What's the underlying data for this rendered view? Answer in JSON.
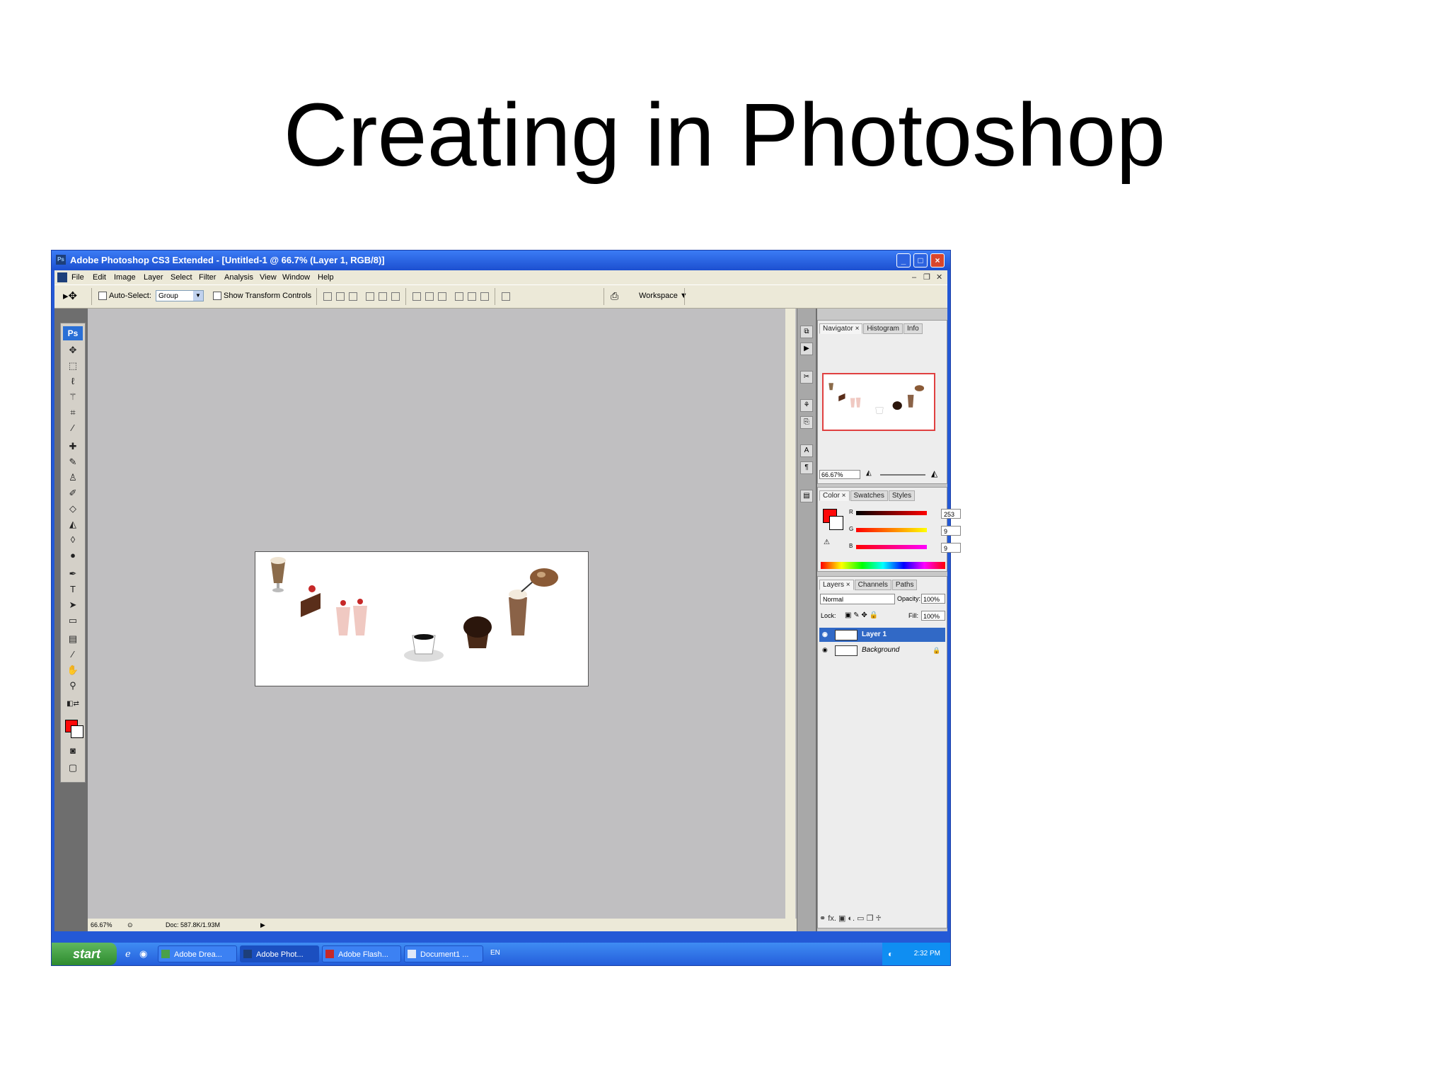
{
  "slide": {
    "title": "Creating in Photoshop"
  },
  "window": {
    "title": "Adobe Photoshop CS3 Extended - [Untitled-1 @ 66.7% (Layer 1, RGB/8)]",
    "menu": [
      "File",
      "Edit",
      "Image",
      "Layer",
      "Select",
      "Filter",
      "Analysis",
      "View",
      "Window",
      "Help"
    ]
  },
  "options": {
    "auto_select_label": "Auto-Select:",
    "auto_select_value": "Group",
    "transform_label": "Show Transform Controls",
    "workspace_label": "Workspace ▼"
  },
  "tools": {
    "logo": "Ps",
    "icons": [
      "move-tool-icon",
      "marquee-tool-icon",
      "lasso-tool-icon",
      "magic-wand-icon",
      "crop-tool-icon",
      "eyedropper-icon",
      "healing-brush-icon",
      "brush-tool-icon",
      "clone-stamp-icon",
      "history-brush-icon",
      "eraser-icon",
      "paint-bucket-icon",
      "blur-tool-icon",
      "dodge-tool-icon",
      "pen-tool-icon",
      "type-tool-icon",
      "path-select-icon",
      "shape-tool-icon",
      "notes-tool-icon",
      "eyedropper-2-icon",
      "hand-tool-icon",
      "zoom-tool-icon"
    ]
  },
  "colors": {
    "foreground": "#fd0909",
    "background": "#ffffff"
  },
  "canvas": {
    "items": [
      "iced-coffee",
      "cake-slice",
      "milkshakes",
      "coffee-cup",
      "muffin",
      "frappe",
      "cookie"
    ]
  },
  "status": {
    "zoom": "66.67%",
    "doc": "Doc: 587.8K/1.93M"
  },
  "navigator": {
    "tabs": [
      "Navigator ×",
      "Histogram",
      "Info"
    ],
    "zoom": "66.67%"
  },
  "color_panel": {
    "tabs": [
      "Color ×",
      "Swatches",
      "Styles"
    ],
    "r_label": "R",
    "r_value": "253",
    "g_label": "G",
    "g_value": "9",
    "b_label": "B",
    "b_value": "9"
  },
  "layers_panel": {
    "tabs": [
      "Layers ×",
      "Channels",
      "Paths"
    ],
    "blend_mode": "Normal",
    "opacity_label": "Opacity:",
    "opacity_value": "100%",
    "lock_label": "Lock:",
    "fill_label": "Fill:",
    "fill_value": "100%",
    "layers": [
      "Layer 1",
      "Background"
    ],
    "footer": "⚭  fx.  ▣  ◐.  ▭  ❒  ♱"
  },
  "taskbar": {
    "start": "start",
    "buttons": [
      "Adobe Drea...",
      "Adobe Phot...",
      "Adobe Flash...",
      "Document1 ..."
    ],
    "lang": "EN",
    "time": "2:32 PM"
  }
}
